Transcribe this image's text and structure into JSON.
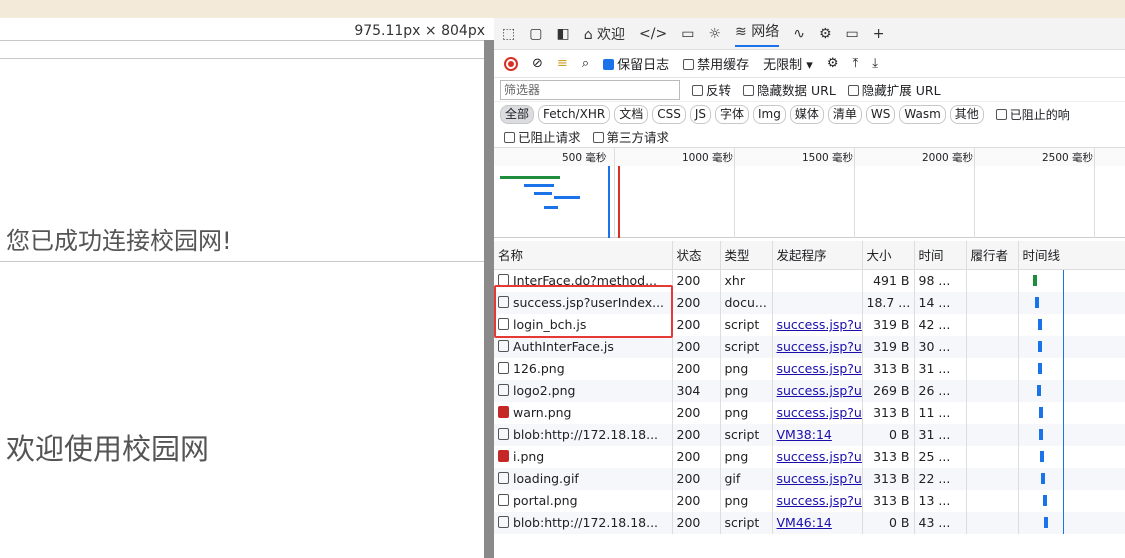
{
  "page": {
    "dimensions": "975.11px × 804px",
    "connected_msg": "您已成功连接校园网!",
    "welcome": "欢迎使用校园网"
  },
  "devtools": {
    "tabs": {
      "welcome": "欢迎",
      "network": "网络",
      "plus": "+"
    },
    "toolbar": {
      "preserve_log": "保留日志",
      "disable_cache": "禁用缓存",
      "throttle": "无限制"
    },
    "filter": {
      "placeholder": "筛选器",
      "invert": "反转",
      "hide_data_url": "隐藏数据 URL",
      "hide_ext_url": "隐藏扩展 URL"
    },
    "types": [
      "全部",
      "Fetch/XHR",
      "文档",
      "CSS",
      "JS",
      "字体",
      "Img",
      "媒体",
      "清单",
      "WS",
      "Wasm",
      "其他"
    ],
    "blocked_response": "已阻止的响",
    "blocked_requests": "已阻止请求",
    "third_party": "第三方请求",
    "overview_ticks": [
      "500 毫秒",
      "1000 毫秒",
      "1500 毫秒",
      "2000 毫秒",
      "2500 毫秒"
    ],
    "columns": [
      "名称",
      "状态",
      "类型",
      "发起程序",
      "大小",
      "时间",
      "履行者",
      "时间线"
    ],
    "rows": [
      {
        "name": "InterFace.do?method...",
        "status": "200",
        "type": "xhr",
        "initiator": "",
        "size": "491 B",
        "time": "98 ...",
        "icon": "doc",
        "tl": 0.1
      },
      {
        "name": "success.jsp?userIndex...",
        "status": "200",
        "type": "docu...",
        "initiator": "",
        "size": "18.7 ...",
        "time": "14 ...",
        "icon": "doc",
        "tl": 0.12
      },
      {
        "name": "login_bch.js",
        "status": "200",
        "type": "script",
        "initiator": "success.jsp?u",
        "size": "319 B",
        "time": "42 ...",
        "icon": "script",
        "tl": 0.15
      },
      {
        "name": "AuthInterFace.js",
        "status": "200",
        "type": "script",
        "initiator": "success.jsp?u",
        "size": "319 B",
        "time": "30 ...",
        "icon": "script",
        "tl": 0.15
      },
      {
        "name": "126.png",
        "status": "200",
        "type": "png",
        "initiator": "success.jsp?u",
        "size": "313 B",
        "time": "31 ...",
        "icon": "img",
        "tl": 0.15
      },
      {
        "name": "logo2.png",
        "status": "304",
        "type": "png",
        "initiator": "success.jsp?u",
        "size": "269 B",
        "time": "26 ...",
        "icon": "img",
        "tl": 0.14
      },
      {
        "name": "warn.png",
        "status": "200",
        "type": "png",
        "initiator": "success.jsp?u",
        "size": "313 B",
        "time": "11 ...",
        "icon": "imgred",
        "tl": 0.16
      },
      {
        "name": "blob:http://172.18.18...",
        "status": "200",
        "type": "script",
        "initiator": "VM38:14",
        "size": "0 B",
        "time": "31 ...",
        "icon": "script",
        "tl": 0.16
      },
      {
        "name": "i.png",
        "status": "200",
        "type": "png",
        "initiator": "success.jsp?u",
        "size": "313 B",
        "time": "25 ...",
        "icon": "imgred",
        "tl": 0.17
      },
      {
        "name": "loading.gif",
        "status": "200",
        "type": "gif",
        "initiator": "success.jsp?u",
        "size": "313 B",
        "time": "22 ...",
        "icon": "img",
        "tl": 0.18
      },
      {
        "name": "portal.png",
        "status": "200",
        "type": "png",
        "initiator": "success.jsp?u",
        "size": "313 B",
        "time": "13 ...",
        "icon": "img",
        "tl": 0.2
      },
      {
        "name": "blob:http://172.18.18...",
        "status": "200",
        "type": "script",
        "initiator": "VM46:14",
        "size": "0 B",
        "time": "43 ...",
        "icon": "script",
        "tl": 0.21
      }
    ]
  }
}
